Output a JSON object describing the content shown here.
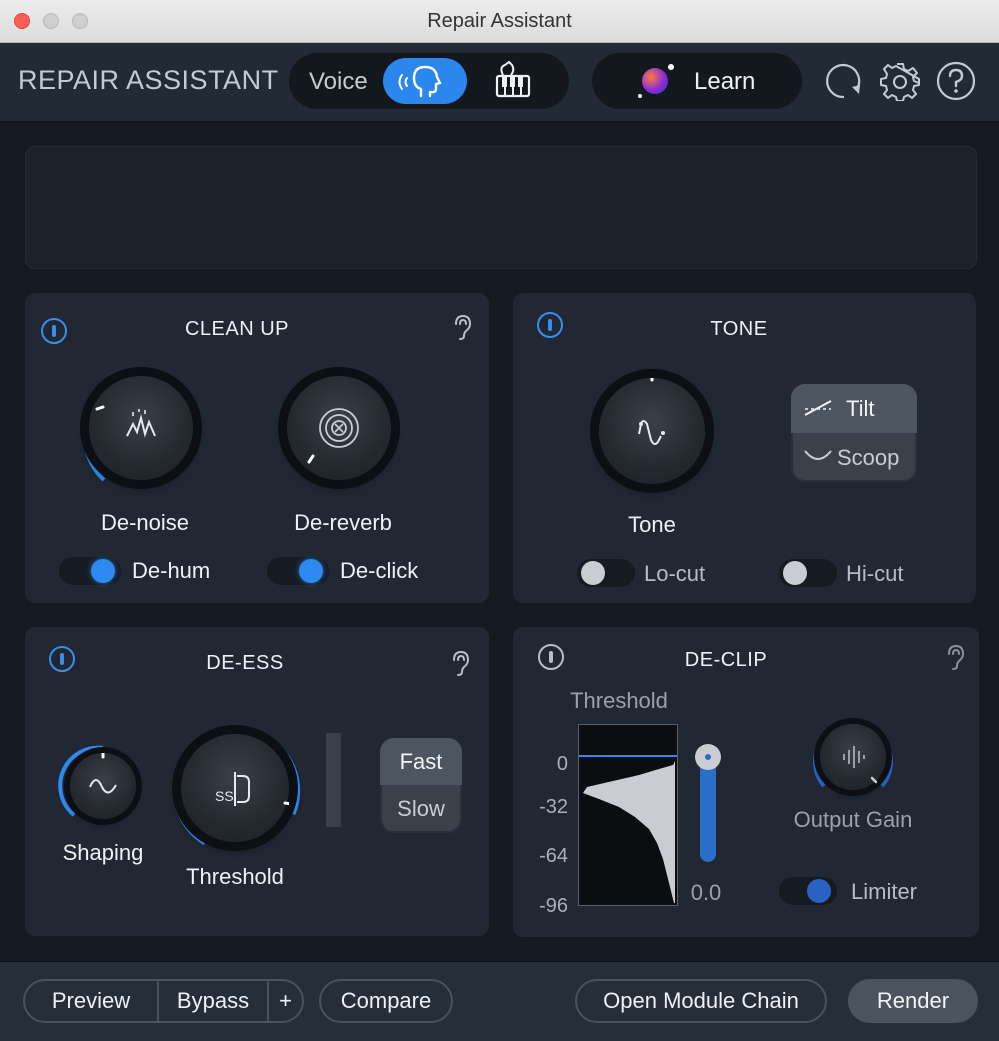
{
  "window": {
    "title": "Repair Assistant"
  },
  "header": {
    "app_title": "REPAIR ASSISTANT",
    "mode": {
      "voice_label": "Voice",
      "selected": "voice"
    },
    "learn_label": "Learn",
    "icons": [
      "undo-icon",
      "gear-icon",
      "help-icon"
    ]
  },
  "clean_up": {
    "title": "CLEAN UP",
    "enabled": true,
    "denoise": {
      "label": "De-noise",
      "icon": "denoise-icon"
    },
    "dereverb": {
      "label": "De-reverb",
      "icon": "dereverb-icon"
    },
    "dehum": {
      "label": "De-hum",
      "on": true
    },
    "declick": {
      "label": "De-click",
      "on": true
    }
  },
  "tone": {
    "title": "TONE",
    "enabled": true,
    "knob_label": "Tone",
    "options": [
      "Tilt",
      "Scoop"
    ],
    "selected": "Tilt",
    "locut": {
      "label": "Lo-cut",
      "on": false
    },
    "hicut": {
      "label": "Hi-cut",
      "on": false
    }
  },
  "de_ess": {
    "title": "DE-ESS",
    "enabled": true,
    "shaping_label": "Shaping",
    "threshold_label": "Threshold",
    "options": [
      "Fast",
      "Slow"
    ],
    "selected": "Fast"
  },
  "de_clip": {
    "title": "DE-CLIP",
    "enabled": false,
    "threshold_label": "Threshold",
    "scale": [
      "0",
      "-32",
      "-64",
      "-96"
    ],
    "threshold_value": "0.0",
    "output_gain_label": "Output Gain",
    "limiter": {
      "label": "Limiter",
      "on": true
    }
  },
  "footer": {
    "preview": "Preview",
    "bypass": "Bypass",
    "plus": "+",
    "compare": "Compare",
    "open_module_chain": "Open Module Chain",
    "render": "Render"
  },
  "colors": {
    "accent": "#2b86ee",
    "panel": "#212833",
    "background": "#151a22"
  }
}
